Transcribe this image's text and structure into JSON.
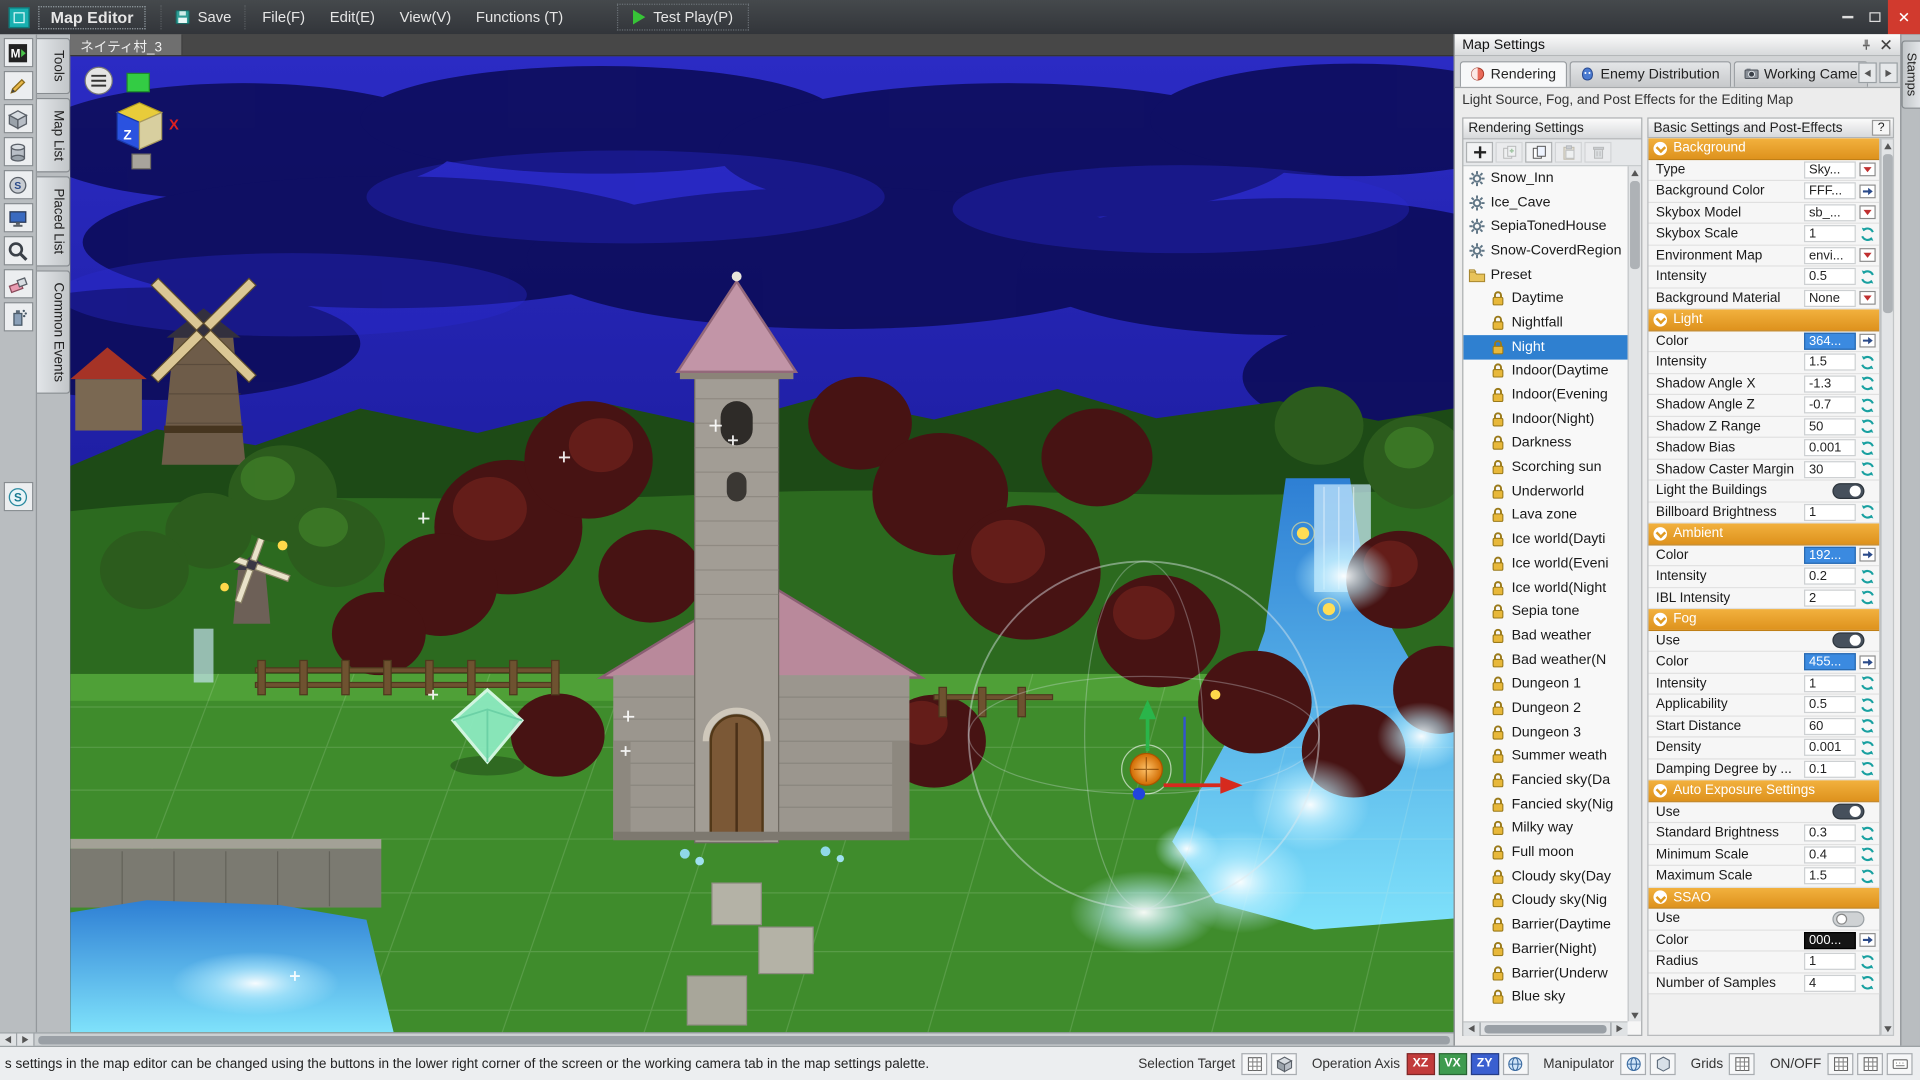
{
  "colors": {
    "selection_blue": "#2f80d0",
    "section_orange": "#e8a02c",
    "night_sky": "#1b1b9a",
    "close_button_red": "#d13a2e"
  },
  "window": {
    "title": "Map Editor",
    "save_label": "Save",
    "menus": [
      "File(F)",
      "Edit(E)",
      "View(V)",
      "Functions (T)"
    ],
    "test_play_label": "Test Play(P)"
  },
  "left_toolbar": {
    "icons": [
      {
        "name": "mode-icon",
        "glyph": "ic-mode"
      },
      {
        "name": "pencil-tool-icon",
        "glyph": "ic-pencil"
      },
      {
        "name": "cube-stamp-tool-icon",
        "glyph": "ic-cube"
      },
      {
        "name": "cylinder-tool-icon",
        "glyph": "ic-cyl"
      },
      {
        "name": "slope-tool-icon",
        "glyph": "ic-disc"
      },
      {
        "name": "monitor-tool-icon",
        "glyph": "ic-monitor"
      },
      {
        "name": "zoom-tool-icon",
        "glyph": "ic-mag"
      },
      {
        "name": "eraser-tool-icon",
        "glyph": "ic-eraser"
      },
      {
        "name": "spray-tool-icon",
        "glyph": "ic-spray"
      },
      {
        "name": "snap-tool-icon",
        "glyph": "ic-s",
        "gap": 120
      }
    ]
  },
  "side_tabs": [
    "Tools",
    "Map List",
    "Placed List",
    "Common Events"
  ],
  "viewport": {
    "tab_label": "ネイティ村_3"
  },
  "axis_widget": {
    "z": "Z",
    "x": "X"
  },
  "stamps_tab": "Stamps",
  "map_settings": {
    "title": "Map Settings",
    "tabs": [
      {
        "label": "Rendering",
        "icon": "ic-render",
        "selected": true
      },
      {
        "label": "Enemy Distribution",
        "icon": "ic-enemy",
        "selected": false
      },
      {
        "label": "Working Came",
        "icon": "ic-camera",
        "selected": false
      }
    ],
    "description": "Light Source, Fog, and Post Effects for the Editing Map",
    "rendering_panel": {
      "title": "Rendering Settings",
      "toolbar": [
        {
          "name": "add-setting-button",
          "glyph": "ic-plus",
          "enabled": true
        },
        {
          "name": "new-folder-button",
          "glyph": "ic-dupe",
          "enabled": false
        },
        {
          "name": "copy-button",
          "glyph": "ic-copy",
          "enabled": true
        },
        {
          "name": "paste-button",
          "glyph": "ic-paste",
          "enabled": false
        },
        {
          "name": "delete-button",
          "glyph": "ic-trash",
          "enabled": false
        }
      ],
      "items": [
        {
          "label": "Snow_Inn",
          "icon": "gear"
        },
        {
          "label": "Ice_Cave",
          "icon": "gear"
        },
        {
          "label": "SepiaTonedHouse",
          "icon": "gear"
        },
        {
          "label": "Snow-CoverdRegion",
          "icon": "gear"
        },
        {
          "label": "Preset",
          "icon": "folder"
        },
        {
          "label": "Daytime",
          "icon": "lock",
          "indent": true
        },
        {
          "label": "Nightfall",
          "icon": "lock",
          "indent": true
        },
        {
          "label": "Night",
          "icon": "lock",
          "indent": true,
          "selected": true
        },
        {
          "label": "Indoor(Daytime",
          "icon": "lock",
          "indent": true
        },
        {
          "label": "Indoor(Evening",
          "icon": "lock",
          "indent": true
        },
        {
          "label": "Indoor(Night)",
          "icon": "lock",
          "indent": true
        },
        {
          "label": "Darkness",
          "icon": "lock",
          "indent": true
        },
        {
          "label": "Scorching sun",
          "icon": "lock",
          "indent": true
        },
        {
          "label": "Underworld",
          "icon": "lock",
          "indent": true
        },
        {
          "label": "Lava zone",
          "icon": "lock",
          "indent": true
        },
        {
          "label": "Ice world(Dayti",
          "icon": "lock",
          "indent": true
        },
        {
          "label": "Ice world(Eveni",
          "icon": "lock",
          "indent": true
        },
        {
          "label": "Ice world(Night",
          "icon": "lock",
          "indent": true
        },
        {
          "label": "Sepia tone",
          "icon": "lock",
          "indent": true
        },
        {
          "label": "Bad weather",
          "icon": "lock",
          "indent": true
        },
        {
          "label": "Bad weather(N",
          "icon": "lock",
          "indent": true
        },
        {
          "label": "Dungeon 1",
          "icon": "lock",
          "indent": true
        },
        {
          "label": "Dungeon 2",
          "icon": "lock",
          "indent": true
        },
        {
          "label": "Dungeon 3",
          "icon": "lock",
          "indent": true
        },
        {
          "label": "Summer weath",
          "icon": "lock",
          "indent": true
        },
        {
          "label": "Fancied sky(Da",
          "icon": "lock",
          "indent": true
        },
        {
          "label": "Fancied sky(Nig",
          "icon": "lock",
          "indent": true
        },
        {
          "label": "Milky way",
          "icon": "lock",
          "indent": true
        },
        {
          "label": "Full moon",
          "icon": "lock",
          "indent": true
        },
        {
          "label": "Cloudy sky(Day",
          "icon": "lock",
          "indent": true
        },
        {
          "label": "Cloudy sky(Nig",
          "icon": "lock",
          "indent": true
        },
        {
          "label": "Barrier(Daytime",
          "icon": "lock",
          "indent": true
        },
        {
          "label": "Barrier(Night)",
          "icon": "lock",
          "indent": true
        },
        {
          "label": "Barrier(Underw",
          "icon": "lock",
          "indent": true
        },
        {
          "label": "Blue sky",
          "icon": "lock",
          "indent": true
        }
      ]
    },
    "properties": {
      "title": "Basic Settings and Post-Effects",
      "help_label": "?",
      "sections": [
        {
          "title": "Background",
          "rows": [
            {
              "label": "Type",
              "value": "Sky...",
              "control": "dropdown"
            },
            {
              "label": "Background Color",
              "value": "FFF...",
              "control": "arrow"
            },
            {
              "label": "Skybox Model",
              "value": "sb_...",
              "control": "dropdown"
            },
            {
              "label": "Skybox Scale",
              "value": "1",
              "control": "spinner"
            },
            {
              "label": "Environment Map",
              "value": "envi...",
              "control": "dropdown"
            },
            {
              "label": "Intensity",
              "value": "0.5",
              "control": "spinner"
            },
            {
              "label": "Background Material",
              "value": "None",
              "control": "dropdown"
            }
          ]
        },
        {
          "title": "Light",
          "rows": [
            {
              "label": "Color",
              "value": "364...",
              "control": "arrow",
              "style": "blue"
            },
            {
              "label": "Intensity",
              "value": "1.5",
              "control": "spinner"
            },
            {
              "label": "Shadow Angle X",
              "value": "-1.3",
              "control": "spinner"
            },
            {
              "label": "Shadow Angle Z",
              "value": "-0.7",
              "control": "spinner"
            },
            {
              "label": "Shadow Z Range",
              "value": "50",
              "control": "spinner"
            },
            {
              "label": "Shadow Bias",
              "value": "0.001",
              "control": "spinner"
            },
            {
              "label": "Shadow Caster Margin",
              "value": "30",
              "control": "spinner"
            },
            {
              "label": "Light the Buildings",
              "value": "on",
              "control": "toggle"
            },
            {
              "label": "Billboard Brightness",
              "value": "1",
              "control": "spinner"
            }
          ]
        },
        {
          "title": "Ambient",
          "rows": [
            {
              "label": "Color",
              "value": "192...",
              "control": "arrow",
              "style": "blue"
            },
            {
              "label": "Intensity",
              "value": "0.2",
              "control": "spinner"
            },
            {
              "label": "IBL Intensity",
              "value": "2",
              "control": "spinner"
            }
          ]
        },
        {
          "title": "Fog",
          "rows": [
            {
              "label": "Use",
              "value": "on",
              "control": "toggle"
            },
            {
              "label": "Color",
              "value": "455...",
              "control": "arrow",
              "style": "blue"
            },
            {
              "label": "Intensity",
              "value": "1",
              "control": "spinner"
            },
            {
              "label": "Applicability",
              "value": "0.5",
              "control": "spinner"
            },
            {
              "label": "Start Distance",
              "value": "60",
              "control": "spinner"
            },
            {
              "label": "Density",
              "value": "0.001",
              "control": "spinner"
            },
            {
              "label": "Damping Degree by ...",
              "value": "0.1",
              "control": "spinner"
            }
          ]
        },
        {
          "title": "Auto Exposure Settings",
          "rows": [
            {
              "label": "Use",
              "value": "on",
              "control": "toggle"
            },
            {
              "label": "Standard Brightness",
              "value": "0.3",
              "control": "spinner"
            },
            {
              "label": "Minimum Scale",
              "value": "0.4",
              "control": "spinner"
            },
            {
              "label": "Maximum Scale",
              "value": "1.5",
              "control": "spinner"
            }
          ]
        },
        {
          "title": "SSAO",
          "rows": [
            {
              "label": "Use",
              "value": "off",
              "control": "toggle"
            },
            {
              "label": "Color",
              "value": "000...",
              "control": "arrow",
              "style": "black"
            },
            {
              "label": "Radius",
              "value": "1",
              "control": "spinner"
            },
            {
              "label": "Number of Samples",
              "value": "4",
              "control": "spinner"
            }
          ]
        }
      ]
    }
  },
  "status_bar": {
    "message": "s settings in the map editor can be changed using the buttons in the lower right corner of the screen or the working camera tab in the map settings palette.",
    "controls": [
      {
        "type": "label",
        "text": "Selection Target"
      },
      {
        "type": "icon",
        "name": "selection-target-stamp-icon",
        "glyph": "ic-grid"
      },
      {
        "type": "icon",
        "name": "selection-target-model-icon",
        "glyph": "ic-cube"
      },
      {
        "type": "label",
        "text": "Operation Axis"
      },
      {
        "type": "axis",
        "text": "XZ",
        "color": "#c23b3b"
      },
      {
        "type": "axis",
        "text": "VX",
        "color": "#3f9b4f"
      },
      {
        "type": "axis",
        "text": "ZY",
        "color": "#3a5fd0"
      },
      {
        "type": "icon",
        "name": "axis-globe-icon",
        "glyph": "ic-globe"
      },
      {
        "type": "label",
        "text": "Manipulator"
      },
      {
        "type": "icon",
        "name": "world-manipulator-icon",
        "glyph": "ic-globe"
      },
      {
        "type": "icon",
        "name": "snap-hex-icon",
        "glyph": "ic-hex"
      },
      {
        "type": "label",
        "text": "Grids"
      },
      {
        "type": "icon",
        "name": "grid-icon",
        "glyph": "ic-grid"
      },
      {
        "type": "label",
        "text": "ON/OFF"
      },
      {
        "type": "icon",
        "name": "grid-xy-icon",
        "glyph": "ic-grid"
      },
      {
        "type": "icon",
        "name": "grid-xz-icon",
        "glyph": "ic-grid"
      },
      {
        "type": "icon",
        "name": "keyboard-icon",
        "glyph": "ic-kbd"
      }
    ]
  }
}
